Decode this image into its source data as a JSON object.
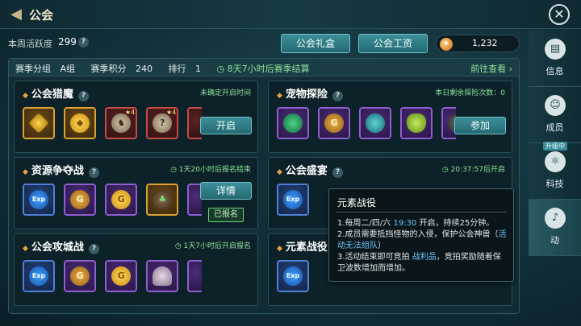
{
  "header": {
    "title": "公会"
  },
  "activity": {
    "label": "本周活跃度",
    "value": "299"
  },
  "buttons": {
    "gift": "公会礼盒",
    "salary": "公会工资"
  },
  "currency": {
    "value": "1,232"
  },
  "season": {
    "group_label": "赛季分组",
    "group_value": "A组",
    "points_label": "赛季积分",
    "points_value": "240",
    "rank_label": "排行",
    "rank_value": "1",
    "timer": "8天7小时后赛季结算",
    "goto": "前往查看"
  },
  "cards": [
    {
      "title": "公会猎魔",
      "status": "未确定开启时间",
      "button": "开启",
      "items": [
        {
          "icon": "gold-gem-icon",
          "star": ""
        },
        {
          "icon": "gold-nuggets-icon",
          "star": ""
        },
        {
          "icon": "beast-mount-icon",
          "star": "4"
        },
        {
          "icon": "beast-mystery-icon",
          "star": "4"
        }
      ]
    },
    {
      "title": "宠物探险",
      "status": "本日剩余探险次数：0",
      "button": "参加",
      "items": [
        {
          "icon": "green-orb-icon"
        },
        {
          "icon": "guild-g-icon"
        },
        {
          "icon": "teal-orb-icon"
        },
        {
          "icon": "potion-bottle-icon"
        },
        {
          "icon": "spider-icon"
        }
      ]
    },
    {
      "title": "资源争夺战",
      "status": "1天20小时后报名结束",
      "button": "详情",
      "badge": "已报名",
      "items": [
        {
          "icon": "exp-icon"
        },
        {
          "icon": "guild-g-icon"
        },
        {
          "icon": "gold-coin-icon"
        },
        {
          "icon": "sprout-icon"
        }
      ]
    },
    {
      "title": "公会盛宴",
      "status": "20:37:57后开启",
      "items": [
        {
          "icon": "exp-icon"
        }
      ]
    },
    {
      "title": "公会攻城战",
      "status": "1天7小时后开启报名",
      "items": [
        {
          "icon": "exp-icon"
        },
        {
          "icon": "guild-g-icon"
        },
        {
          "icon": "gold-coin-icon"
        },
        {
          "icon": "powder-pile-icon"
        }
      ]
    },
    {
      "title": "元素战役",
      "items": [
        {
          "icon": "exp-icon"
        }
      ]
    }
  ],
  "icons": {
    "exp_text": "Exp",
    "g_text": "G"
  },
  "side_nav": [
    {
      "label": "信息",
      "icon": "info-icon"
    },
    {
      "label": "成员",
      "icon": "members-icon"
    },
    {
      "label": "科技",
      "icon": "tech-icon",
      "badge": "升级中"
    },
    {
      "label": "动",
      "icon": "activity-bell-icon"
    }
  ],
  "tooltip": {
    "title": "元素战役",
    "line1_a": "1.每周二/四/六 ",
    "line1_time": "19:30",
    "line1_b": " 开启，持续25分钟。",
    "line2_a": "2.成员需要抵挡怪物的入侵，保护公会神兽（",
    "line2_hl": "活动无法组队",
    "line2_b": "）",
    "line3_a": "3.活动结束即可竞拍 ",
    "line3_hl": "战利品",
    "line3_b": "，竞拍奖励随着保卫波数增加而增加。"
  }
}
